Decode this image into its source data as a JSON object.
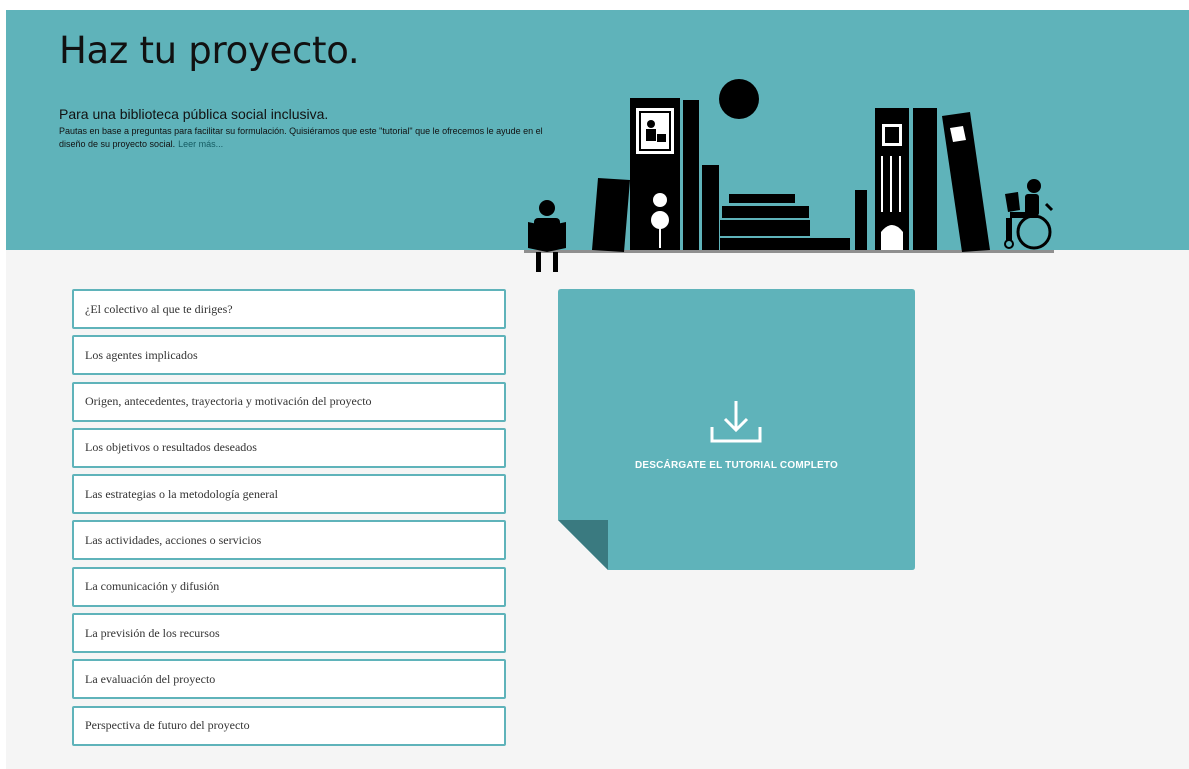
{
  "hero": {
    "title": "Haz tu proyecto.",
    "subtitle": "Para una biblioteca pública social inclusiva.",
    "description": "Pautas en base a preguntas para facilitar su formulación. Quisiéramos que este \"tutorial\" que le ofrecemos le ayude en el diseño de su proyecto social.",
    "read_more": "Leer más...",
    "background_color": "#5fb3ba",
    "illustration": "library-books-readers-illustration"
  },
  "topics": [
    {
      "label": "¿El colectivo al que te diriges?"
    },
    {
      "label": "Los agentes implicados"
    },
    {
      "label": "Origen, antecedentes, trayectoria y motivación del proyecto"
    },
    {
      "label": "Los objetivos o resultados deseados"
    },
    {
      "label": "Las estrategias o la metodología general"
    },
    {
      "label": "Las actividades, acciones o servicios"
    },
    {
      "label": "La comunicación y difusión"
    },
    {
      "label": "La previsión de los recursos"
    },
    {
      "label": "La evaluación del proyecto"
    },
    {
      "label": "Perspectiva de futuro del proyecto"
    }
  ],
  "download": {
    "label": "DESCÁRGATE EL TUTORIAL COMPLETO",
    "icon": "download-icon",
    "color": "#5fb3ba",
    "fold_color": "#3a7a80"
  }
}
